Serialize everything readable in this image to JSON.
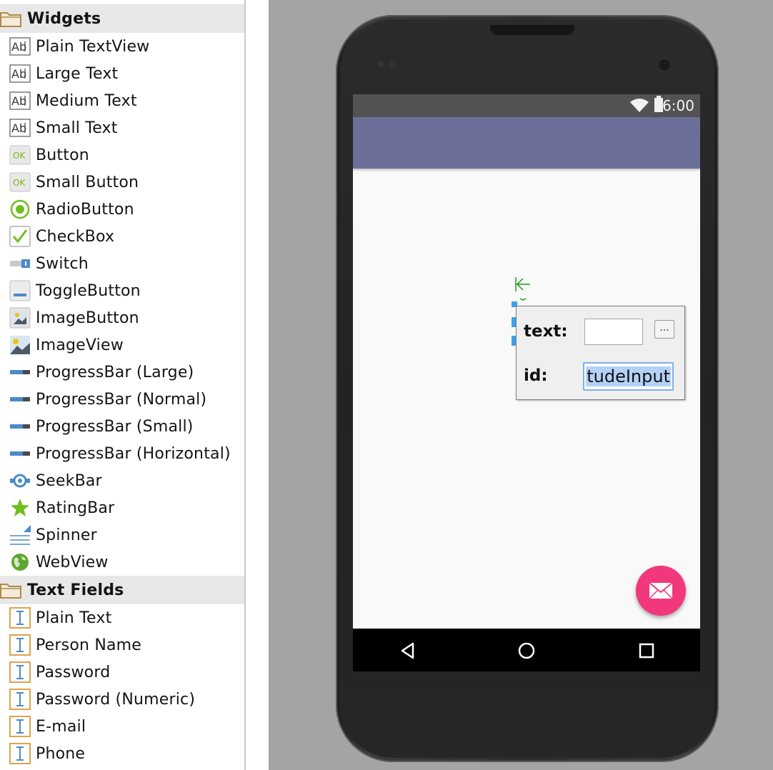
{
  "palette": {
    "groups": [
      {
        "label": "Widgets"
      },
      {
        "label": "Text Fields"
      }
    ],
    "widgets": [
      {
        "label": "Plain TextView",
        "icon": "ab-text-icon"
      },
      {
        "label": "Large Text",
        "icon": "ab-text-icon"
      },
      {
        "label": "Medium Text",
        "icon": "ab-text-icon"
      },
      {
        "label": "Small Text",
        "icon": "ab-text-icon"
      },
      {
        "label": "Button",
        "icon": "ok-button-icon"
      },
      {
        "label": "Small Button",
        "icon": "ok-button-icon"
      },
      {
        "label": "RadioButton",
        "icon": "radio-icon"
      },
      {
        "label": "CheckBox",
        "icon": "checkbox-icon"
      },
      {
        "label": "Switch",
        "icon": "switch-icon"
      },
      {
        "label": "ToggleButton",
        "icon": "toggle-icon"
      },
      {
        "label": "ImageButton",
        "icon": "image-button-icon"
      },
      {
        "label": "ImageView",
        "icon": "image-view-icon"
      },
      {
        "label": "ProgressBar (Large)",
        "icon": "progressbar-icon"
      },
      {
        "label": "ProgressBar (Normal)",
        "icon": "progressbar-icon"
      },
      {
        "label": "ProgressBar (Small)",
        "icon": "progressbar-icon"
      },
      {
        "label": "ProgressBar (Horizontal)",
        "icon": "progressbar-icon"
      },
      {
        "label": "SeekBar",
        "icon": "seekbar-icon"
      },
      {
        "label": "RatingBar",
        "icon": "star-icon"
      },
      {
        "label": "Spinner",
        "icon": "spinner-icon"
      },
      {
        "label": "WebView",
        "icon": "globe-icon"
      }
    ],
    "text_fields": [
      {
        "label": "Plain Text",
        "icon": "text-cursor-icon"
      },
      {
        "label": "Person Name",
        "icon": "text-cursor-icon"
      },
      {
        "label": "Password",
        "icon": "text-cursor-icon"
      },
      {
        "label": "Password (Numeric)",
        "icon": "text-cursor-icon"
      },
      {
        "label": "E-mail",
        "icon": "text-cursor-icon"
      },
      {
        "label": "Phone",
        "icon": "text-cursor-icon"
      }
    ]
  },
  "device": {
    "status_time": "6:00",
    "appbar_color": "#6c6f9a",
    "fab_color": "#f1387c",
    "fab_icon": "envelope-icon"
  },
  "property_popup": {
    "text_label": "text:",
    "text_value": "",
    "more_label": "...",
    "id_label": "id:",
    "id_value": "tudeInput"
  }
}
